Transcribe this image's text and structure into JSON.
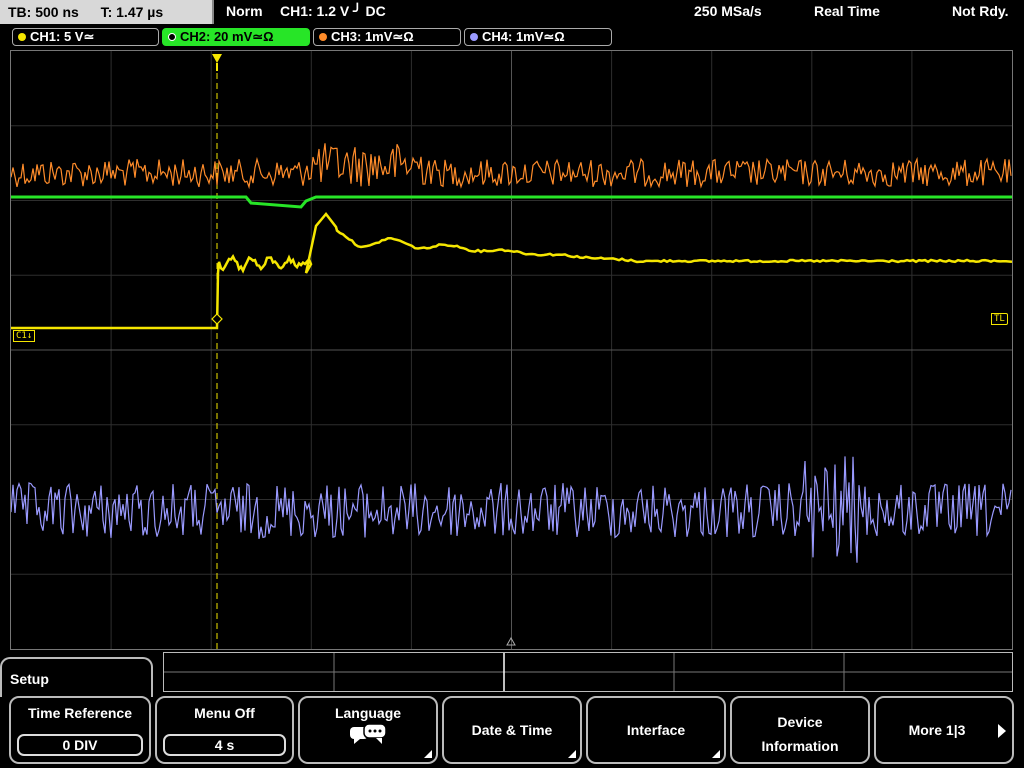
{
  "status": {
    "timebase": "TB: 500 ns",
    "trigger_time": "T: 1.47 µs",
    "mode": "Norm",
    "trigger": "CH1: 1.2 V ╯ DC",
    "sample_rate": "250 MSa/s",
    "acquisition": "Real Time",
    "state": "Not Rdy."
  },
  "channels": [
    {
      "label": "CH1: 5 V≃",
      "color": "#f5e600",
      "active": false
    },
    {
      "label": "CH2: 20 mV≃Ω",
      "color": "#27e527",
      "active": true
    },
    {
      "label": "CH3: 1mV≃Ω",
      "color": "#ff8c2a",
      "active": false
    },
    {
      "label": "CH4: 1mV≃Ω",
      "color": "#9a9aff",
      "active": false
    }
  ],
  "markers": {
    "c1": "C1↓",
    "tl": "TL"
  },
  "menu": {
    "title": "Setup",
    "softkeys": [
      {
        "label": "Time Reference",
        "value": "0 DIV"
      },
      {
        "label": "Menu Off",
        "value": "4 s"
      },
      {
        "label": "Language",
        "icon": "speech-bubble-icon"
      },
      {
        "label": "Date & Time"
      },
      {
        "label": "Interface"
      },
      {
        "label": "Device Information"
      },
      {
        "label": "More 1|3"
      }
    ]
  },
  "icons": {
    "trigger_marker": "trigger-down-arrow-icon",
    "language": "speech-bubble-icon",
    "next": "right-arrow-icon"
  },
  "colors": {
    "ch1": "#f5e600",
    "ch2": "#27e527",
    "ch3": "#ff8c2a",
    "ch4": "#9a9aff",
    "grid": "#333333"
  }
}
